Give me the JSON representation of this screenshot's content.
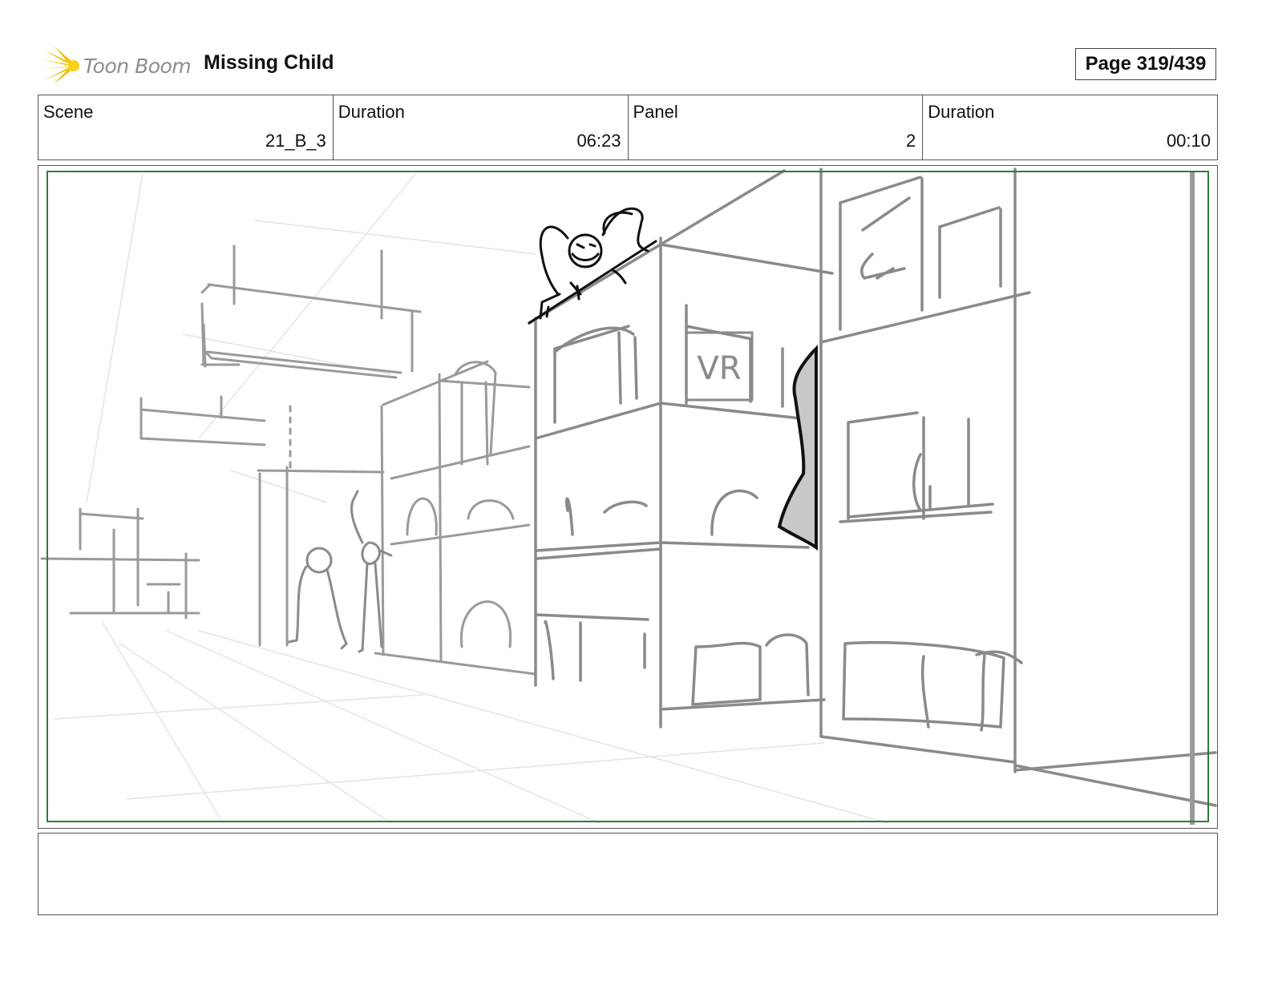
{
  "header": {
    "logo_text": "Toon Boom",
    "project_title": "Missing Child",
    "page_indicator": "Page 319/439"
  },
  "info": {
    "scene_label": "Scene",
    "scene_value": "21_B_3",
    "scene_duration_label": "Duration",
    "scene_duration_value": "06:23",
    "panel_label": "Panel",
    "panel_value": "2",
    "panel_duration_label": "Duration",
    "panel_duration_value": "00:10"
  },
  "panel": {
    "safe_frame_color": "#2e7d32",
    "sketch_color": "#8a8a8a",
    "sign_text": "VR"
  },
  "notes": {
    "text": ""
  },
  "colors": {
    "logo_star": "#f2c200",
    "border": "#555555"
  }
}
